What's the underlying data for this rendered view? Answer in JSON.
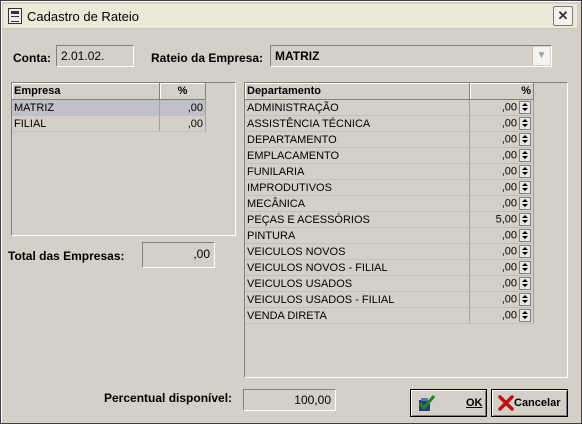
{
  "window": {
    "title": "Cadastro de Rateio",
    "close_label": "✕"
  },
  "conta": {
    "label": "Conta:",
    "value": "2.01.02."
  },
  "rateio": {
    "label": "Rateio da Empresa:",
    "value": "MATRIZ"
  },
  "empresas": {
    "headers": [
      "Empresa",
      "%"
    ],
    "rows": [
      {
        "nome": "MATRIZ",
        "pct": ",00"
      },
      {
        "nome": "FILIAL",
        "pct": ",00"
      }
    ]
  },
  "total": {
    "label": "Total das Empresas:",
    "value": ",00"
  },
  "departamentos": {
    "headers": [
      "Departamento",
      "%"
    ],
    "rows": [
      {
        "nome": "ADMINISTRAÇÃO",
        "pct": ",00"
      },
      {
        "nome": "ASSISTÊNCIA TÉCNICA",
        "pct": ",00"
      },
      {
        "nome": "DEPARTAMENTO",
        "pct": ",00"
      },
      {
        "nome": "EMPLACAMENTO",
        "pct": ",00"
      },
      {
        "nome": "FUNILARIA",
        "pct": ",00"
      },
      {
        "nome": "IMPRODUTIVOS",
        "pct": ",00"
      },
      {
        "nome": "MECÂNICA",
        "pct": ",00"
      },
      {
        "nome": "PEÇAS E ACESSÓRIOS",
        "pct": "5,00"
      },
      {
        "nome": "PINTURA",
        "pct": ",00"
      },
      {
        "nome": "VEICULOS NOVOS",
        "pct": ",00"
      },
      {
        "nome": "VEICULOS NOVOS - FILIAL",
        "pct": ",00"
      },
      {
        "nome": "VEICULOS USADOS",
        "pct": ",00"
      },
      {
        "nome": "VEICULOS USADOS - FILIAL",
        "pct": ",00"
      },
      {
        "nome": "VENDA DIRETA",
        "pct": ",00"
      }
    ]
  },
  "percentual": {
    "label": "Percentual disponível:",
    "value": "100,00"
  },
  "buttons": {
    "ok": "OK",
    "cancelar": "Cancelar"
  }
}
